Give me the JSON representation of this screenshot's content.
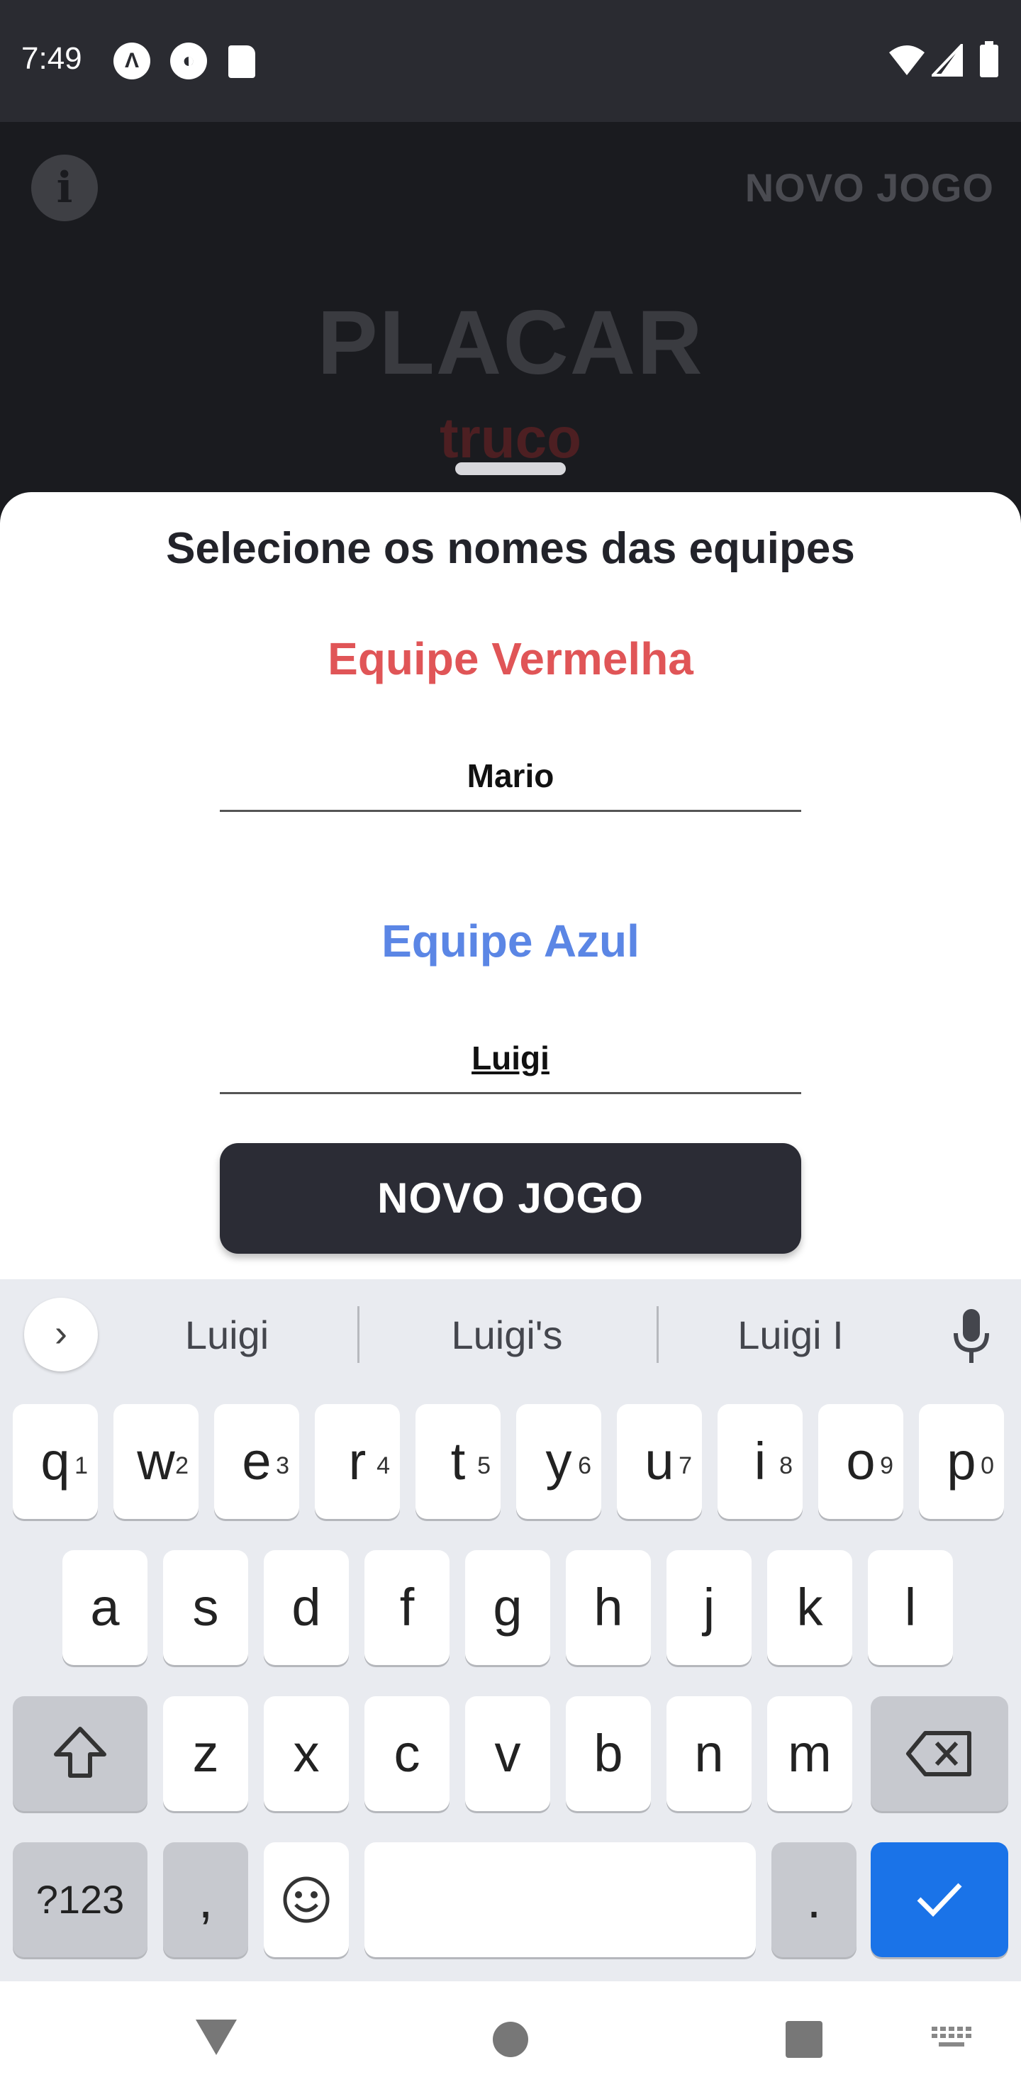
{
  "status_bar": {
    "time": "7:49"
  },
  "app_header": {
    "new_game_label": "NOVO JOGO",
    "title": "PLACAR",
    "subtitle": "truco"
  },
  "sheet": {
    "title": "Selecione os nomes das equipes",
    "red_team_label": "Equipe Vermelha",
    "red_team_value": "Mario",
    "blue_team_label": "Equipe Azul",
    "blue_team_value": "Luigi",
    "new_game_button": "NOVO JOGO"
  },
  "keyboard": {
    "suggestions": [
      "Luigi",
      "Luigi's",
      "Luigi I"
    ],
    "row1": [
      "q",
      "w",
      "e",
      "r",
      "t",
      "y",
      "u",
      "i",
      "o",
      "p"
    ],
    "row1_hints": [
      "1",
      "2",
      "3",
      "4",
      "5",
      "6",
      "7",
      "8",
      "9",
      "0"
    ],
    "row2": [
      "a",
      "s",
      "d",
      "f",
      "g",
      "h",
      "j",
      "k",
      "l"
    ],
    "row3": [
      "z",
      "x",
      "c",
      "v",
      "b",
      "n",
      "m"
    ],
    "symbols_label": "?123",
    "comma": ",",
    "period": "."
  },
  "colors": {
    "red_team": "#e05557",
    "blue_team": "#5b86e5",
    "enter_key": "#1a73e8",
    "button_bg": "#2b2c35"
  }
}
